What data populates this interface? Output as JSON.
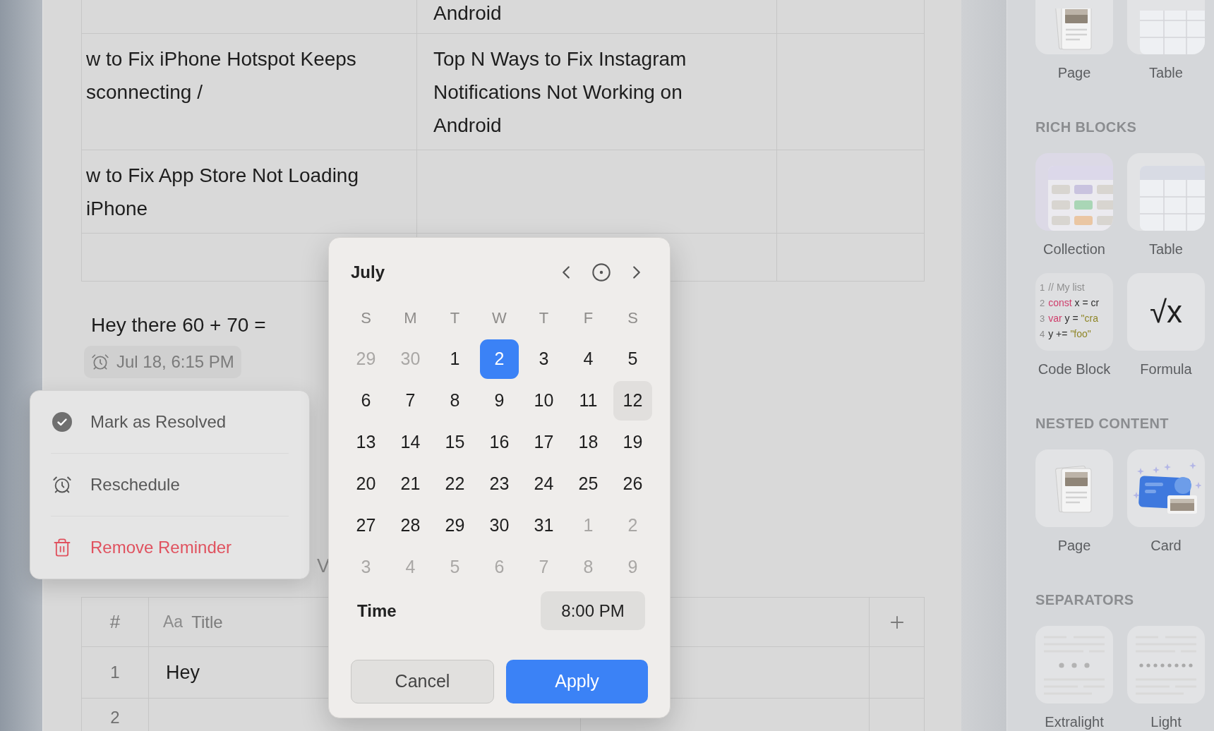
{
  "document": {
    "top_table": {
      "rows": [
        {
          "column_2": [
            "Android"
          ]
        },
        {
          "column_1": [
            "w to Fix iPhone Hotspot Keeps",
            "sconnecting /"
          ],
          "column_2": [
            "Top N Ways to Fix Instagram",
            "Notifications Not Working on",
            "Android"
          ]
        },
        {
          "column_1": [
            "w to Fix App Store Not Loading",
            "iPhone"
          ]
        },
        {}
      ]
    },
    "note": {
      "text": "Hey there 60 + 70 =",
      "reminder": "Jul 18, 6:15 PM"
    },
    "partial_text": "V",
    "bottom_table": {
      "columns": [
        {
          "label": "#"
        },
        {
          "type_label": "Aa",
          "label": "Title"
        }
      ],
      "rows": [
        {
          "number": "1",
          "title": "Hey"
        },
        {
          "number": "2"
        }
      ]
    }
  },
  "context_menu": {
    "items": [
      {
        "kind": "resolve",
        "label": "Mark as Resolved"
      },
      {
        "kind": "reschedule",
        "label": "Reschedule"
      },
      {
        "kind": "remove",
        "label": "Remove Reminder"
      }
    ]
  },
  "date_picker": {
    "month": "July",
    "weekdays": [
      "S",
      "M",
      "T",
      "W",
      "T",
      "F",
      "S"
    ],
    "days": [
      {
        "day": "29",
        "in_month": false,
        "selected": false,
        "highlighted": false
      },
      {
        "day": "30",
        "in_month": false,
        "selected": false,
        "highlighted": false
      },
      {
        "day": "1",
        "in_month": true,
        "selected": false,
        "highlighted": false
      },
      {
        "day": "2",
        "in_month": true,
        "selected": true,
        "highlighted": false
      },
      {
        "day": "3",
        "in_month": true,
        "selected": false,
        "highlighted": false
      },
      {
        "day": "4",
        "in_month": true,
        "selected": false,
        "highlighted": false
      },
      {
        "day": "5",
        "in_month": true,
        "selected": false,
        "highlighted": false
      },
      {
        "day": "6",
        "in_month": true,
        "selected": false,
        "highlighted": false
      },
      {
        "day": "7",
        "in_month": true,
        "selected": false,
        "highlighted": false
      },
      {
        "day": "8",
        "in_month": true,
        "selected": false,
        "highlighted": false
      },
      {
        "day": "9",
        "in_month": true,
        "selected": false,
        "highlighted": false
      },
      {
        "day": "10",
        "in_month": true,
        "selected": false,
        "highlighted": false
      },
      {
        "day": "11",
        "in_month": true,
        "selected": false,
        "highlighted": false
      },
      {
        "day": "12",
        "in_month": true,
        "selected": false,
        "highlighted": true
      },
      {
        "day": "13",
        "in_month": true,
        "selected": false,
        "highlighted": false
      },
      {
        "day": "14",
        "in_month": true,
        "selected": false,
        "highlighted": false
      },
      {
        "day": "15",
        "in_month": true,
        "selected": false,
        "highlighted": false
      },
      {
        "day": "16",
        "in_month": true,
        "selected": false,
        "highlighted": false
      },
      {
        "day": "17",
        "in_month": true,
        "selected": false,
        "highlighted": false
      },
      {
        "day": "18",
        "in_month": true,
        "selected": false,
        "highlighted": false
      },
      {
        "day": "19",
        "in_month": true,
        "selected": false,
        "highlighted": false
      },
      {
        "day": "20",
        "in_month": true,
        "selected": false,
        "highlighted": false
      },
      {
        "day": "21",
        "in_month": true,
        "selected": false,
        "highlighted": false
      },
      {
        "day": "22",
        "in_month": true,
        "selected": false,
        "highlighted": false
      },
      {
        "day": "23",
        "in_month": true,
        "selected": false,
        "highlighted": false
      },
      {
        "day": "24",
        "in_month": true,
        "selected": false,
        "highlighted": false
      },
      {
        "day": "25",
        "in_month": true,
        "selected": false,
        "highlighted": false
      },
      {
        "day": "26",
        "in_month": true,
        "selected": false,
        "highlighted": false
      },
      {
        "day": "27",
        "in_month": true,
        "selected": false,
        "highlighted": false
      },
      {
        "day": "28",
        "in_month": true,
        "selected": false,
        "highlighted": false
      },
      {
        "day": "29",
        "in_month": true,
        "selected": false,
        "highlighted": false
      },
      {
        "day": "30",
        "in_month": true,
        "selected": false,
        "highlighted": false
      },
      {
        "day": "31",
        "in_month": true,
        "selected": false,
        "highlighted": false
      },
      {
        "day": "1",
        "in_month": false,
        "selected": false,
        "highlighted": false
      },
      {
        "day": "2",
        "in_month": false,
        "selected": false,
        "highlighted": false
      },
      {
        "day": "3",
        "in_month": false,
        "selected": false,
        "highlighted": false
      },
      {
        "day": "4",
        "in_month": false,
        "selected": false,
        "highlighted": false
      },
      {
        "day": "5",
        "in_month": false,
        "selected": false,
        "highlighted": false
      },
      {
        "day": "6",
        "in_month": false,
        "selected": false,
        "highlighted": false
      },
      {
        "day": "7",
        "in_month": false,
        "selected": false,
        "highlighted": false
      },
      {
        "day": "8",
        "in_month": false,
        "selected": false,
        "highlighted": false
      },
      {
        "day": "9",
        "in_month": false,
        "selected": false,
        "highlighted": false
      }
    ],
    "time": {
      "label": "Time",
      "value": "8:00 PM"
    },
    "buttons": [
      {
        "kind": "secondary",
        "label": "Cancel"
      },
      {
        "kind": "primary",
        "label": "Apply"
      }
    ]
  },
  "sidebar": {
    "sections": [
      {
        "clipped": true,
        "items": [
          {
            "kind": "page",
            "label": "Page"
          },
          {
            "kind": "table",
            "label": "Table"
          }
        ]
      },
      {
        "clipped": false,
        "title": "RICH BLOCKS",
        "items": [
          {
            "kind": "collection",
            "label": "Collection"
          },
          {
            "kind": "table",
            "label": "Table"
          },
          {
            "kind": "code",
            "label": "Code Block",
            "code_lines": [
              {
                "number": "1",
                "tokens": [
                  {
                    "kind": "comment",
                    "text": "// My list"
                  }
                ]
              },
              {
                "number": "2",
                "tokens": [
                  {
                    "kind": "keyword",
                    "text": "const"
                  },
                  {
                    "kind": "plain",
                    "text": "x = cr"
                  }
                ]
              },
              {
                "number": "3",
                "tokens": [
                  {
                    "kind": "keyword",
                    "text": "var"
                  },
                  {
                    "kind": "plain",
                    "text": "y ="
                  },
                  {
                    "kind": "string",
                    "text": "\"cra"
                  }
                ]
              },
              {
                "number": "4",
                "tokens": [
                  {
                    "kind": "plain",
                    "text": "y +="
                  },
                  {
                    "kind": "string",
                    "text": "\"foo\""
                  }
                ]
              }
            ]
          },
          {
            "kind": "formula",
            "label": "Formula",
            "glyph": "√x"
          }
        ]
      },
      {
        "clipped": false,
        "title": "NESTED CONTENT",
        "items": [
          {
            "kind": "page",
            "label": "Page"
          },
          {
            "kind": "card",
            "label": "Card"
          }
        ]
      },
      {
        "clipped": false,
        "title": "SEPARATORS",
        "items": [
          {
            "kind": "sparse",
            "label": "Extralight"
          },
          {
            "kind": "dense",
            "label": "Light"
          }
        ]
      }
    ]
  }
}
